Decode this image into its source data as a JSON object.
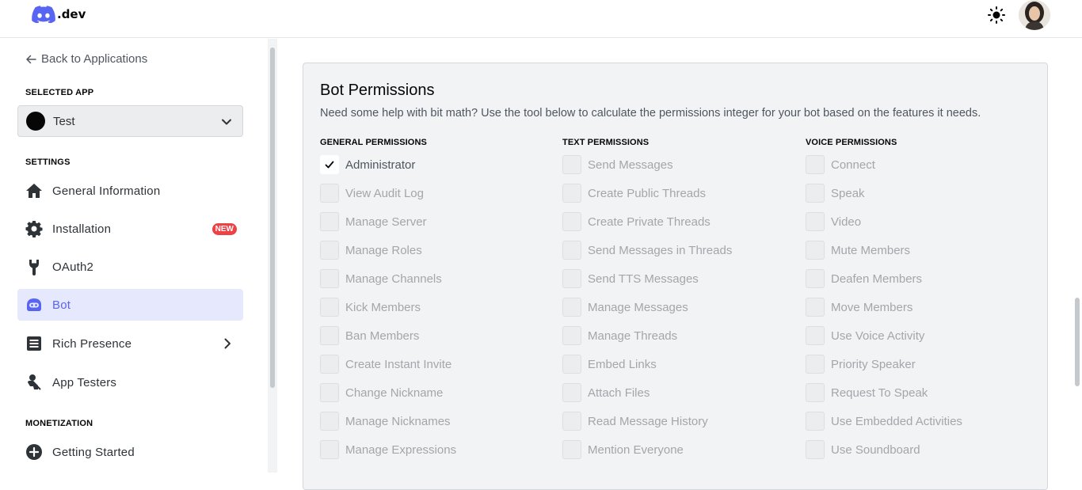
{
  "topbar": {
    "logo_text": ".dev",
    "theme_icon": "sun-icon",
    "avatar_icon": "user-avatar"
  },
  "sidebar": {
    "back_label": "Back to Applications",
    "selected_app_heading": "SELECTED APP",
    "selected_app": "Test",
    "settings_heading": "SETTINGS",
    "items": [
      {
        "label": "General Information",
        "icon": "home-icon"
      },
      {
        "label": "Installation",
        "icon": "gear-icon",
        "badge": "NEW"
      },
      {
        "label": "OAuth2",
        "icon": "wrench-icon"
      },
      {
        "label": "Bot",
        "icon": "bot-icon",
        "active": true
      },
      {
        "label": "Rich Presence",
        "icon": "document-icon"
      },
      {
        "label": "App Testers",
        "icon": "user-icon"
      }
    ],
    "monetization_heading": "MONETIZATION",
    "monetization_items": [
      {
        "label": "Getting Started",
        "icon": "plus-circle-icon"
      }
    ]
  },
  "permissions": {
    "title": "Bot Permissions",
    "description": "Need some help with bit math? Use the tool below to calculate the permissions integer for your bot based on the features it needs.",
    "columns": [
      {
        "heading": "GENERAL PERMISSIONS",
        "items": [
          {
            "label": "Administrator",
            "checked": true
          },
          {
            "label": "View Audit Log",
            "checked": false
          },
          {
            "label": "Manage Server",
            "checked": false
          },
          {
            "label": "Manage Roles",
            "checked": false
          },
          {
            "label": "Manage Channels",
            "checked": false
          },
          {
            "label": "Kick Members",
            "checked": false
          },
          {
            "label": "Ban Members",
            "checked": false
          },
          {
            "label": "Create Instant Invite",
            "checked": false
          },
          {
            "label": "Change Nickname",
            "checked": false
          },
          {
            "label": "Manage Nicknames",
            "checked": false
          },
          {
            "label": "Manage Expressions",
            "checked": false
          }
        ]
      },
      {
        "heading": "TEXT PERMISSIONS",
        "items": [
          {
            "label": "Send Messages",
            "checked": false
          },
          {
            "label": "Create Public Threads",
            "checked": false
          },
          {
            "label": "Create Private Threads",
            "checked": false
          },
          {
            "label": "Send Messages in Threads",
            "checked": false
          },
          {
            "label": "Send TTS Messages",
            "checked": false
          },
          {
            "label": "Manage Messages",
            "checked": false
          },
          {
            "label": "Manage Threads",
            "checked": false
          },
          {
            "label": "Embed Links",
            "checked": false
          },
          {
            "label": "Attach Files",
            "checked": false
          },
          {
            "label": "Read Message History",
            "checked": false
          },
          {
            "label": "Mention Everyone",
            "checked": false
          }
        ]
      },
      {
        "heading": "VOICE PERMISSIONS",
        "items": [
          {
            "label": "Connect",
            "checked": false
          },
          {
            "label": "Speak",
            "checked": false
          },
          {
            "label": "Video",
            "checked": false
          },
          {
            "label": "Mute Members",
            "checked": false
          },
          {
            "label": "Deafen Members",
            "checked": false
          },
          {
            "label": "Move Members",
            "checked": false
          },
          {
            "label": "Use Voice Activity",
            "checked": false
          },
          {
            "label": "Priority Speaker",
            "checked": false
          },
          {
            "label": "Request To Speak",
            "checked": false
          },
          {
            "label": "Use Embedded Activities",
            "checked": false
          },
          {
            "label": "Use Soundboard",
            "checked": false
          }
        ]
      }
    ]
  },
  "colors": {
    "accent": "#5865f2",
    "badge": "#ed4245",
    "active_bg": "#e6e8fd"
  }
}
